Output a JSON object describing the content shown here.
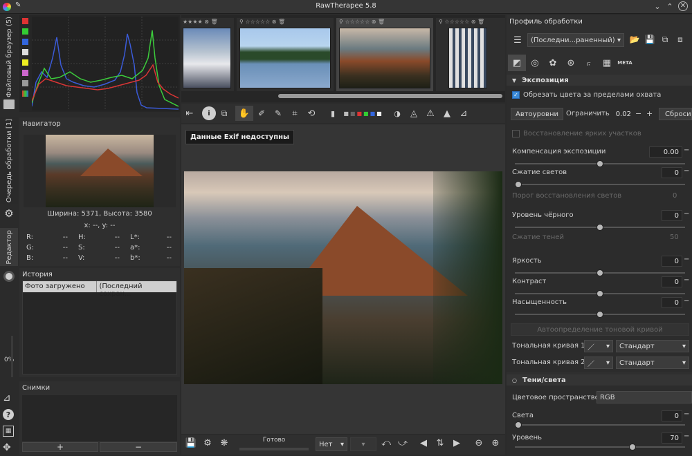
{
  "app": {
    "title": "RawTherapee 5.8"
  },
  "left_tabs": {
    "file_browser": "Файловый браузер (5)",
    "queue": "Очередь обработки [1]",
    "editor": "Редактор"
  },
  "left_progress": "0%",
  "navigator": {
    "title": "Навигатор",
    "size": "Ширина: 5371, Высота: 3580",
    "coords": "x: --, y: --",
    "readouts": [
      [
        "R:",
        "--",
        "H:",
        "--",
        "L*:",
        "--"
      ],
      [
        "G:",
        "--",
        "S:",
        "--",
        "a*:",
        "--"
      ],
      [
        "B:",
        "--",
        "V:",
        "--",
        "b*:",
        "--"
      ]
    ]
  },
  "history": {
    "title": "История",
    "col1": "Фото загружено",
    "col2": "(Последний сохран..."
  },
  "snapshots": {
    "title": "Снимки",
    "add": "+",
    "remove": "−"
  },
  "viewer": {
    "tooltip": "Данные Exif недоступны",
    "status": "Готово",
    "zoom_select": "Нет"
  },
  "right": {
    "profile_title": "Профиль обработки",
    "profile_value": "(Последни...раненный)",
    "exposure": {
      "title": "Экспозиция",
      "clip_label": "Обрезать цвета за пределами охвата",
      "auto": "Автоуровни",
      "limit_label": "Ограничить",
      "limit_value": "0.02",
      "reset": "Сброси",
      "recovery": "Восстановление ярких участков",
      "comp": "Компенсация экспозиции",
      "comp_v": "0.00",
      "comp_pos": 0.5,
      "hl": "Сжатие светов",
      "hl_v": "0",
      "hl_pos": 0.0,
      "hlt": "Порог восстановления светов",
      "hlt_v": "0",
      "black": "Уровень чёрного",
      "black_v": "0",
      "black_pos": 0.5,
      "shc": "Сжатие теней",
      "shc_v": "50",
      "bright": "Яркость",
      "bright_v": "0",
      "bright_pos": 0.5,
      "contrast": "Контраст",
      "contrast_v": "0",
      "contrast_pos": 0.5,
      "sat": "Насыщенность",
      "sat_v": "0",
      "sat_pos": 0.5,
      "autotone": "Автоопределение тоновой кривой",
      "tc1": "Тональная кривая 1:",
      "tc2": "Тональная кривая 2:",
      "tc_mode": "Стандарт"
    },
    "shadows": {
      "title": "Тени/света",
      "cs_label": "Цветовое пространство:",
      "cs_value": "RGB",
      "hl": "Света",
      "hl_v": "0",
      "hl_pos": 0.0,
      "lvl": "Уровень",
      "lvl_v": "70",
      "lvl_pos": 0.7
    }
  },
  "colors": {
    "accent": "#3b8ad8"
  }
}
